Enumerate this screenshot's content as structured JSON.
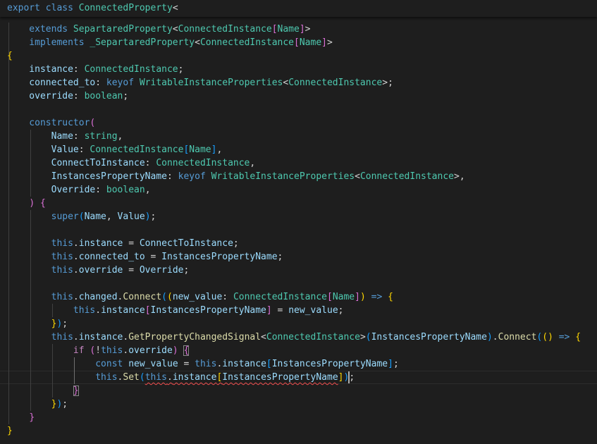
{
  "editor": {
    "sticky": [
      {
        "t": "export ",
        "c": "kw"
      },
      {
        "t": "class ",
        "c": "kw"
      },
      {
        "t": "ConnectedProperty",
        "c": "typ"
      },
      {
        "t": "<",
        "c": "op"
      }
    ],
    "lines": [
      [
        {
          "t": "    extends ",
          "c": "kw"
        },
        {
          "t": "SepartaredProperty",
          "c": "typ"
        },
        {
          "t": "<",
          "c": "op"
        },
        {
          "t": "ConnectedInstance",
          "c": "typ"
        },
        {
          "t": "[",
          "c": "b2"
        },
        {
          "t": "Name",
          "c": "typ"
        },
        {
          "t": "]",
          "c": "b2"
        },
        {
          "t": ">",
          "c": "op"
        }
      ],
      [
        {
          "t": "    implements ",
          "c": "kw"
        },
        {
          "t": "_SepartaredProperty",
          "c": "typ"
        },
        {
          "t": "<",
          "c": "op"
        },
        {
          "t": "ConnectedInstance",
          "c": "typ"
        },
        {
          "t": "[",
          "c": "b2"
        },
        {
          "t": "Name",
          "c": "typ"
        },
        {
          "t": "]",
          "c": "b2"
        },
        {
          "t": ">",
          "c": "op"
        }
      ],
      [
        {
          "t": "{",
          "c": "b1"
        }
      ],
      [
        {
          "t": "    instance",
          "c": "var"
        },
        {
          "t": ": ",
          "c": "op"
        },
        {
          "t": "ConnectedInstance",
          "c": "typ"
        },
        {
          "t": ";",
          "c": "op"
        }
      ],
      [
        {
          "t": "    connected_to",
          "c": "var"
        },
        {
          "t": ": ",
          "c": "op"
        },
        {
          "t": "keyof ",
          "c": "kw"
        },
        {
          "t": "WritableInstanceProperties",
          "c": "typ"
        },
        {
          "t": "<",
          "c": "op"
        },
        {
          "t": "ConnectedInstance",
          "c": "typ"
        },
        {
          "t": ">;",
          "c": "op"
        }
      ],
      [
        {
          "t": "    override",
          "c": "var"
        },
        {
          "t": ": ",
          "c": "op"
        },
        {
          "t": "boolean",
          "c": "typ"
        },
        {
          "t": ";",
          "c": "op"
        }
      ],
      [],
      [
        {
          "t": "    constructor",
          "c": "kw"
        },
        {
          "t": "(",
          "c": "b2"
        }
      ],
      [
        {
          "t": "        Name",
          "c": "var"
        },
        {
          "t": ": ",
          "c": "op"
        },
        {
          "t": "string",
          "c": "typ"
        },
        {
          "t": ",",
          "c": "op"
        }
      ],
      [
        {
          "t": "        Value",
          "c": "var"
        },
        {
          "t": ": ",
          "c": "op"
        },
        {
          "t": "ConnectedInstance",
          "c": "typ"
        },
        {
          "t": "[",
          "c": "b3"
        },
        {
          "t": "Name",
          "c": "typ"
        },
        {
          "t": "]",
          "c": "b3"
        },
        {
          "t": ",",
          "c": "op"
        }
      ],
      [
        {
          "t": "        ConnectToInstance",
          "c": "var"
        },
        {
          "t": ": ",
          "c": "op"
        },
        {
          "t": "ConnectedInstance",
          "c": "typ"
        },
        {
          "t": ",",
          "c": "op"
        }
      ],
      [
        {
          "t": "        InstancesPropertyName",
          "c": "var"
        },
        {
          "t": ": ",
          "c": "op"
        },
        {
          "t": "keyof ",
          "c": "kw"
        },
        {
          "t": "WritableInstanceProperties",
          "c": "typ"
        },
        {
          "t": "<",
          "c": "op"
        },
        {
          "t": "ConnectedInstance",
          "c": "typ"
        },
        {
          "t": ">,",
          "c": "op"
        }
      ],
      [
        {
          "t": "        Override",
          "c": "var"
        },
        {
          "t": ": ",
          "c": "op"
        },
        {
          "t": "boolean",
          "c": "typ"
        },
        {
          "t": ",",
          "c": "op"
        }
      ],
      [
        {
          "t": "    ",
          "c": "op"
        },
        {
          "t": ")",
          "c": "b2"
        },
        {
          "t": " ",
          "c": "op"
        },
        {
          "t": "{",
          "c": "b2"
        }
      ],
      [
        {
          "t": "        super",
          "c": "kw"
        },
        {
          "t": "(",
          "c": "b3"
        },
        {
          "t": "Name",
          "c": "var"
        },
        {
          "t": ", ",
          "c": "op"
        },
        {
          "t": "Value",
          "c": "var"
        },
        {
          "t": ")",
          "c": "b3"
        },
        {
          "t": ";",
          "c": "op"
        }
      ],
      [],
      [
        {
          "t": "        this",
          "c": "kw"
        },
        {
          "t": ".",
          "c": "op"
        },
        {
          "t": "instance",
          "c": "var"
        },
        {
          "t": " = ",
          "c": "op"
        },
        {
          "t": "ConnectToInstance",
          "c": "var"
        },
        {
          "t": ";",
          "c": "op"
        }
      ],
      [
        {
          "t": "        this",
          "c": "kw"
        },
        {
          "t": ".",
          "c": "op"
        },
        {
          "t": "connected_to",
          "c": "var"
        },
        {
          "t": " = ",
          "c": "op"
        },
        {
          "t": "InstancesPropertyName",
          "c": "var"
        },
        {
          "t": ";",
          "c": "op"
        }
      ],
      [
        {
          "t": "        this",
          "c": "kw"
        },
        {
          "t": ".",
          "c": "op"
        },
        {
          "t": "override",
          "c": "var"
        },
        {
          "t": " = ",
          "c": "op"
        },
        {
          "t": "Override",
          "c": "var"
        },
        {
          "t": ";",
          "c": "op"
        }
      ],
      [],
      [
        {
          "t": "        this",
          "c": "kw"
        },
        {
          "t": ".",
          "c": "op"
        },
        {
          "t": "changed",
          "c": "var"
        },
        {
          "t": ".",
          "c": "op"
        },
        {
          "t": "Connect",
          "c": "fn"
        },
        {
          "t": "(",
          "c": "b3"
        },
        {
          "t": "(",
          "c": "b1"
        },
        {
          "t": "new_value",
          "c": "var"
        },
        {
          "t": ": ",
          "c": "op"
        },
        {
          "t": "ConnectedInstance",
          "c": "typ"
        },
        {
          "t": "[",
          "c": "b2"
        },
        {
          "t": "Name",
          "c": "typ"
        },
        {
          "t": "]",
          "c": "b2"
        },
        {
          "t": ")",
          "c": "b1"
        },
        {
          "t": " ",
          "c": "op"
        },
        {
          "t": "=>",
          "c": "kw"
        },
        {
          "t": " ",
          "c": "op"
        },
        {
          "t": "{",
          "c": "b1"
        }
      ],
      [
        {
          "t": "            this",
          "c": "kw"
        },
        {
          "t": ".",
          "c": "op"
        },
        {
          "t": "instance",
          "c": "var"
        },
        {
          "t": "[",
          "c": "b2"
        },
        {
          "t": "InstancesPropertyName",
          "c": "var"
        },
        {
          "t": "]",
          "c": "b2"
        },
        {
          "t": " = ",
          "c": "op"
        },
        {
          "t": "new_value",
          "c": "var"
        },
        {
          "t": ";",
          "c": "op"
        }
      ],
      [
        {
          "t": "        ",
          "c": "op"
        },
        {
          "t": "}",
          "c": "b1"
        },
        {
          "t": ")",
          "c": "b3"
        },
        {
          "t": ";",
          "c": "op"
        }
      ],
      [
        {
          "t": "        this",
          "c": "kw"
        },
        {
          "t": ".",
          "c": "op"
        },
        {
          "t": "instance",
          "c": "var"
        },
        {
          "t": ".",
          "c": "op"
        },
        {
          "t": "GetPropertyChangedSignal",
          "c": "fn"
        },
        {
          "t": "<",
          "c": "op"
        },
        {
          "t": "ConnectedInstance",
          "c": "typ"
        },
        {
          "t": ">",
          "c": "op"
        },
        {
          "t": "(",
          "c": "b3"
        },
        {
          "t": "InstancesPropertyName",
          "c": "var"
        },
        {
          "t": ")",
          "c": "b3"
        },
        {
          "t": ".",
          "c": "op"
        },
        {
          "t": "Connect",
          "c": "fn"
        },
        {
          "t": "(",
          "c": "b3"
        },
        {
          "t": "(",
          "c": "b1"
        },
        {
          "t": ")",
          "c": "b1"
        },
        {
          "t": " ",
          "c": "op"
        },
        {
          "t": "=>",
          "c": "kw"
        },
        {
          "t": " ",
          "c": "op"
        },
        {
          "t": "{",
          "c": "b1"
        }
      ],
      [
        {
          "t": "            if",
          "c": "ctl"
        },
        {
          "t": " ",
          "c": "op"
        },
        {
          "t": "(",
          "c": "b2"
        },
        {
          "t": "!",
          "c": "op"
        },
        {
          "t": "this",
          "c": "kw"
        },
        {
          "t": ".",
          "c": "op"
        },
        {
          "t": "override",
          "c": "var"
        },
        {
          "t": ")",
          "c": "b2"
        },
        {
          "t": " ",
          "c": "op"
        },
        {
          "t": "{",
          "c": "b2 bm"
        }
      ],
      [
        {
          "t": "                const",
          "c": "kw"
        },
        {
          "t": " ",
          "c": "op"
        },
        {
          "t": "new_value",
          "c": "var"
        },
        {
          "t": " = ",
          "c": "op"
        },
        {
          "t": "this",
          "c": "kw"
        },
        {
          "t": ".",
          "c": "op"
        },
        {
          "t": "instance",
          "c": "var"
        },
        {
          "t": "[",
          "c": "b3"
        },
        {
          "t": "InstancesPropertyName",
          "c": "var"
        },
        {
          "t": "]",
          "c": "b3"
        },
        {
          "t": ";",
          "c": "op"
        }
      ],
      [
        {
          "t": "                this",
          "c": "kw"
        },
        {
          "t": ".",
          "c": "op"
        },
        {
          "t": "Set",
          "c": "fn"
        },
        {
          "t": "(",
          "c": "b3"
        },
        {
          "t": "this",
          "c": "kw squig"
        },
        {
          "t": ".",
          "c": "op squig"
        },
        {
          "t": "instance",
          "c": "var squig"
        },
        {
          "t": "[",
          "c": "b1 squig"
        },
        {
          "t": "InstancesPropertyName",
          "c": "var squig"
        },
        {
          "t": "]",
          "c": "b1"
        },
        {
          "t": ")",
          "c": "b3"
        },
        {
          "t": ";",
          "c": "op"
        }
      ],
      [
        {
          "t": "            ",
          "c": "op"
        },
        {
          "t": "}",
          "c": "b2 bm"
        }
      ],
      [
        {
          "t": "        ",
          "c": "op"
        },
        {
          "t": "}",
          "c": "b1"
        },
        {
          "t": ")",
          "c": "b3"
        },
        {
          "t": ";",
          "c": "op"
        }
      ],
      [
        {
          "t": "    ",
          "c": "op"
        },
        {
          "t": "}",
          "c": "b2"
        }
      ],
      [
        {
          "t": "}",
          "c": "b1"
        }
      ]
    ]
  }
}
